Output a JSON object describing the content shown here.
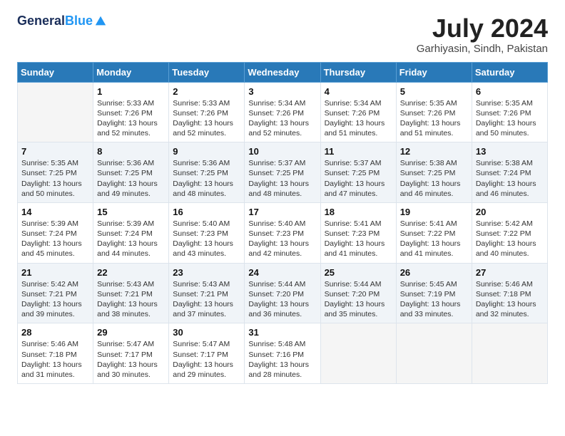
{
  "header": {
    "logo_line1": "General",
    "logo_line2": "Blue",
    "month_year": "July 2024",
    "location": "Garhiyasin, Sindh, Pakistan"
  },
  "days_of_week": [
    "Sunday",
    "Monday",
    "Tuesday",
    "Wednesday",
    "Thursday",
    "Friday",
    "Saturday"
  ],
  "weeks": [
    [
      {
        "day": "",
        "info": ""
      },
      {
        "day": "1",
        "info": "Sunrise: 5:33 AM\nSunset: 7:26 PM\nDaylight: 13 hours\nand 52 minutes."
      },
      {
        "day": "2",
        "info": "Sunrise: 5:33 AM\nSunset: 7:26 PM\nDaylight: 13 hours\nand 52 minutes."
      },
      {
        "day": "3",
        "info": "Sunrise: 5:34 AM\nSunset: 7:26 PM\nDaylight: 13 hours\nand 52 minutes."
      },
      {
        "day": "4",
        "info": "Sunrise: 5:34 AM\nSunset: 7:26 PM\nDaylight: 13 hours\nand 51 minutes."
      },
      {
        "day": "5",
        "info": "Sunrise: 5:35 AM\nSunset: 7:26 PM\nDaylight: 13 hours\nand 51 minutes."
      },
      {
        "day": "6",
        "info": "Sunrise: 5:35 AM\nSunset: 7:26 PM\nDaylight: 13 hours\nand 50 minutes."
      }
    ],
    [
      {
        "day": "7",
        "info": "Sunrise: 5:35 AM\nSunset: 7:25 PM\nDaylight: 13 hours\nand 50 minutes."
      },
      {
        "day": "8",
        "info": "Sunrise: 5:36 AM\nSunset: 7:25 PM\nDaylight: 13 hours\nand 49 minutes."
      },
      {
        "day": "9",
        "info": "Sunrise: 5:36 AM\nSunset: 7:25 PM\nDaylight: 13 hours\nand 48 minutes."
      },
      {
        "day": "10",
        "info": "Sunrise: 5:37 AM\nSunset: 7:25 PM\nDaylight: 13 hours\nand 48 minutes."
      },
      {
        "day": "11",
        "info": "Sunrise: 5:37 AM\nSunset: 7:25 PM\nDaylight: 13 hours\nand 47 minutes."
      },
      {
        "day": "12",
        "info": "Sunrise: 5:38 AM\nSunset: 7:25 PM\nDaylight: 13 hours\nand 46 minutes."
      },
      {
        "day": "13",
        "info": "Sunrise: 5:38 AM\nSunset: 7:24 PM\nDaylight: 13 hours\nand 46 minutes."
      }
    ],
    [
      {
        "day": "14",
        "info": "Sunrise: 5:39 AM\nSunset: 7:24 PM\nDaylight: 13 hours\nand 45 minutes."
      },
      {
        "day": "15",
        "info": "Sunrise: 5:39 AM\nSunset: 7:24 PM\nDaylight: 13 hours\nand 44 minutes."
      },
      {
        "day": "16",
        "info": "Sunrise: 5:40 AM\nSunset: 7:23 PM\nDaylight: 13 hours\nand 43 minutes."
      },
      {
        "day": "17",
        "info": "Sunrise: 5:40 AM\nSunset: 7:23 PM\nDaylight: 13 hours\nand 42 minutes."
      },
      {
        "day": "18",
        "info": "Sunrise: 5:41 AM\nSunset: 7:23 PM\nDaylight: 13 hours\nand 41 minutes."
      },
      {
        "day": "19",
        "info": "Sunrise: 5:41 AM\nSunset: 7:22 PM\nDaylight: 13 hours\nand 41 minutes."
      },
      {
        "day": "20",
        "info": "Sunrise: 5:42 AM\nSunset: 7:22 PM\nDaylight: 13 hours\nand 40 minutes."
      }
    ],
    [
      {
        "day": "21",
        "info": "Sunrise: 5:42 AM\nSunset: 7:21 PM\nDaylight: 13 hours\nand 39 minutes."
      },
      {
        "day": "22",
        "info": "Sunrise: 5:43 AM\nSunset: 7:21 PM\nDaylight: 13 hours\nand 38 minutes."
      },
      {
        "day": "23",
        "info": "Sunrise: 5:43 AM\nSunset: 7:21 PM\nDaylight: 13 hours\nand 37 minutes."
      },
      {
        "day": "24",
        "info": "Sunrise: 5:44 AM\nSunset: 7:20 PM\nDaylight: 13 hours\nand 36 minutes."
      },
      {
        "day": "25",
        "info": "Sunrise: 5:44 AM\nSunset: 7:20 PM\nDaylight: 13 hours\nand 35 minutes."
      },
      {
        "day": "26",
        "info": "Sunrise: 5:45 AM\nSunset: 7:19 PM\nDaylight: 13 hours\nand 33 minutes."
      },
      {
        "day": "27",
        "info": "Sunrise: 5:46 AM\nSunset: 7:18 PM\nDaylight: 13 hours\nand 32 minutes."
      }
    ],
    [
      {
        "day": "28",
        "info": "Sunrise: 5:46 AM\nSunset: 7:18 PM\nDaylight: 13 hours\nand 31 minutes."
      },
      {
        "day": "29",
        "info": "Sunrise: 5:47 AM\nSunset: 7:17 PM\nDaylight: 13 hours\nand 30 minutes."
      },
      {
        "day": "30",
        "info": "Sunrise: 5:47 AM\nSunset: 7:17 PM\nDaylight: 13 hours\nand 29 minutes."
      },
      {
        "day": "31",
        "info": "Sunrise: 5:48 AM\nSunset: 7:16 PM\nDaylight: 13 hours\nand 28 minutes."
      },
      {
        "day": "",
        "info": ""
      },
      {
        "day": "",
        "info": ""
      },
      {
        "day": "",
        "info": ""
      }
    ]
  ]
}
